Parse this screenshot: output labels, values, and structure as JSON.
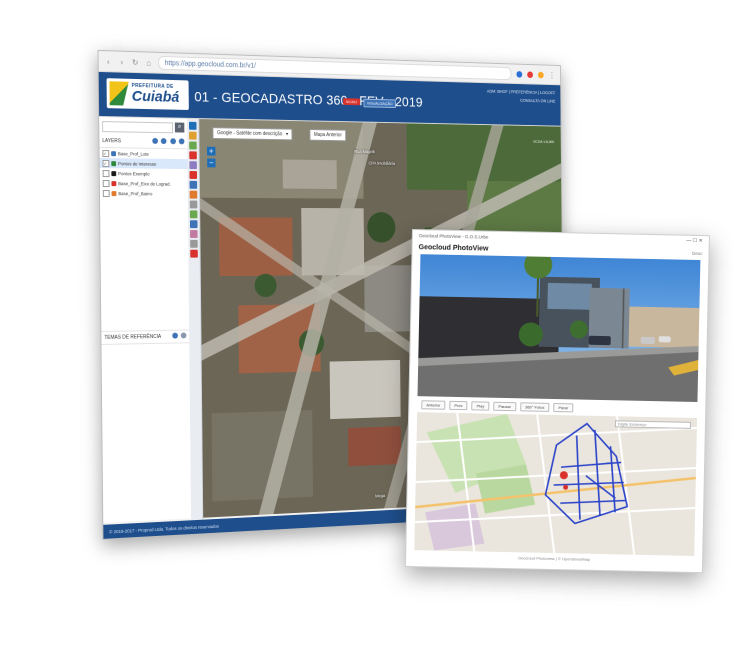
{
  "browser": {
    "url": "https://app.geocloud.com.br/v1/",
    "icons": [
      "back-icon",
      "forward-icon",
      "reload-icon",
      "home-icon"
    ]
  },
  "header": {
    "logo_top": "PREFEITURA DE",
    "logo_city": "Cuiabá",
    "title": "01 - GEOCADASTRO 360 - FEV - 2019",
    "badge_red": "SIGNO",
    "badge_blue": "VISUALIZAÇÃO",
    "user_links": [
      "ADM: BHOF  |  PREFERÊNCIA  |  LOGOFF",
      "CONSULTA ON LINE"
    ]
  },
  "layers": {
    "title": "LAYERS",
    "items": [
      {
        "label": "Base_Prof_Lote",
        "color": "#3e74b7",
        "checked": true,
        "selected": false
      },
      {
        "label": "Pontos de Interesse",
        "color": "#2f8a3c",
        "checked": true,
        "selected": true
      },
      {
        "label": "Pontos Exemplo",
        "color": "#1a1a1a",
        "checked": false,
        "selected": false
      },
      {
        "label": "Base_Prof_Eixo de Lograd.",
        "color": "#d9312b",
        "checked": false,
        "selected": false
      },
      {
        "label": "Base_Prof_Bairro",
        "color": "#e07a2e",
        "checked": false,
        "selected": false
      }
    ],
    "references_title": "TEMAS DE REFERÊNCIA"
  },
  "map": {
    "basemap_select": "Google - Satélite com descrição",
    "previous_button": "Mapa Anterior",
    "scale": "SCDA 1:6,000",
    "poi": [
      "Rua Magelli",
      "CPA Imobiliária",
      "Mega"
    ]
  },
  "footer": "© 2019-2017 - Proprod Ltda. Todos os direitos reservados",
  "photoview": {
    "window_title": "Geocloud PhotoView - G.O.S.Urbe",
    "title": "Geocloud PhotoView",
    "right_label": "Geoc",
    "controls": [
      "Anterior",
      "Próx",
      "Play",
      "Pausar",
      "360° Fotos",
      "Parar"
    ],
    "search_placeholder": "Digite Endereço",
    "attribution": "Geocloud Photoview | © OpenStreetMap"
  },
  "colors": {
    "brand_blue": "#1e4e8c",
    "accent_red": "#d9312b",
    "route_blue": "#2a43c9"
  }
}
